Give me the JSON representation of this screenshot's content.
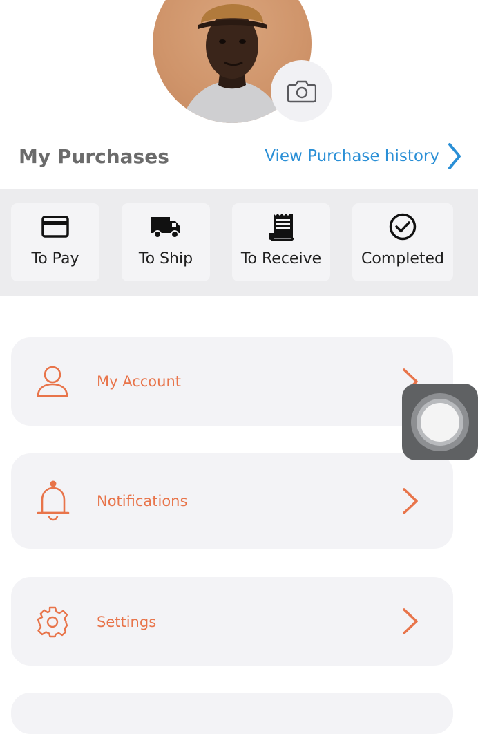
{
  "profile": {
    "avatar_icon": "person-photo",
    "camera_icon": "camera-icon"
  },
  "purchases": {
    "title": "My Purchases",
    "history_link": "View Purchase history",
    "link_color": "#2a8fd6"
  },
  "status_items": [
    {
      "label": "To Pay",
      "icon": "credit-card-icon"
    },
    {
      "label": "To Ship",
      "icon": "truck-icon"
    },
    {
      "label": "To Receive",
      "icon": "receipt-icon"
    },
    {
      "label": "Completed",
      "icon": "check-circle-icon"
    }
  ],
  "menu": [
    {
      "label": "My Account",
      "icon": "user-icon"
    },
    {
      "label": "Notifications",
      "icon": "bell-icon"
    },
    {
      "label": "Settings",
      "icon": "gear-icon"
    }
  ],
  "colors": {
    "accent": "#e8744a",
    "card_bg": "#f3f3f6",
    "strip_bg": "#ececee"
  }
}
